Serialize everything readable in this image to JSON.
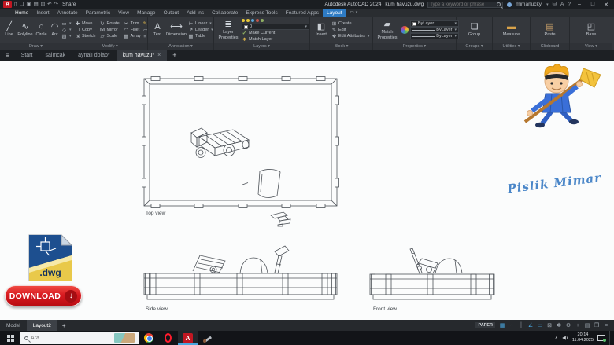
{
  "colors": {
    "tab_active_blue": "#2e7bc4",
    "status_blue": "#4aa7e0",
    "download_red": "#cf1117",
    "watermark_blue": "#4a86c8"
  },
  "titlebar": {
    "logo_letter": "A",
    "quick_icons": [
      {
        "name": "new-file-icon",
        "glyph": "▯"
      },
      {
        "name": "open-folder-icon",
        "glyph": "❒"
      },
      {
        "name": "save-icon",
        "glyph": "▣"
      },
      {
        "name": "save-all-icon",
        "glyph": "▤"
      },
      {
        "name": "plot-icon",
        "glyph": "⊞"
      },
      {
        "name": "undo-icon",
        "glyph": "↶"
      },
      {
        "name": "redo-icon",
        "glyph": "↷"
      }
    ],
    "share_label": "Share",
    "app_title": "Autodesk AutoCAD 2024",
    "doc_title": "kum havuzu.dwg",
    "search_placeholder": "Type a keyword or phrase",
    "username": "mimarlucky",
    "window": {
      "minimize": "–",
      "restore": "□",
      "close": "✕"
    }
  },
  "ribbon_tabs": [
    {
      "label": "Home"
    },
    {
      "label": "Insert"
    },
    {
      "label": "Annotate"
    },
    {
      "label": "Parametric"
    },
    {
      "label": "View"
    },
    {
      "label": "Manage"
    },
    {
      "label": "Output"
    },
    {
      "label": "Add-ins"
    },
    {
      "label": "Collaborate"
    },
    {
      "label": "Express Tools"
    },
    {
      "label": "Featured Apps"
    },
    {
      "label": "Layout"
    }
  ],
  "panels": {
    "draw": {
      "title": "Draw ▾",
      "tools": [
        {
          "glyph": "╱",
          "label": "Line"
        },
        {
          "glyph": "∿",
          "label": "Polyline"
        },
        {
          "glyph": "○",
          "label": "Circle"
        },
        {
          "glyph": "◠",
          "label": "Arc"
        }
      ],
      "minis": [
        {
          "glyph": "▭"
        },
        {
          "glyph": "◇"
        },
        {
          "glyph": "▨"
        }
      ]
    },
    "modify": {
      "title": "Modify ▾",
      "tools": [
        {
          "glyph": "✚",
          "label": "Move"
        },
        {
          "glyph": "❐",
          "label": "Copy"
        },
        {
          "glyph": "⇲",
          "label": "Stretch"
        },
        {
          "glyph": "↻",
          "label": "Rotate"
        },
        {
          "glyph": "⋈",
          "label": "Mirror"
        },
        {
          "glyph": "▱",
          "label": "Scale"
        },
        {
          "glyph": "✂",
          "label": "Trim"
        },
        {
          "glyph": "◠",
          "label": "Fillet"
        },
        {
          "glyph": "▦",
          "label": "Array"
        }
      ],
      "minis": [
        {
          "glyph": "✎"
        },
        {
          "glyph": "▱"
        },
        {
          "glyph": "≡"
        }
      ]
    },
    "annotation": {
      "title": "Annotation ▾",
      "big": [
        {
          "glyph": "A",
          "label": "Text"
        },
        {
          "glyph": "⟷",
          "label": "Dimension"
        }
      ],
      "small": [
        {
          "glyph": "⊢",
          "label": "Linear"
        },
        {
          "glyph": "↗",
          "label": "Leader"
        },
        {
          "glyph": "▦",
          "label": "Table"
        }
      ]
    },
    "layers": {
      "title": "Layers ▾",
      "big_glyph": "≣",
      "big_label": "Layer Properties",
      "layer_value": "0",
      "row1_label": "Make Current",
      "row2_label": "Match Layer",
      "row1_glyph": "✔",
      "row2_glyph": "❖"
    },
    "block": {
      "title": "Block ▾",
      "big_glyph": "◧",
      "big_label": "Insert",
      "rows": [
        {
          "glyph": "⊞",
          "label": "Create"
        },
        {
          "glyph": "✎",
          "label": "Edit"
        },
        {
          "glyph": "❖",
          "label": "Edit Attributes"
        }
      ]
    },
    "properties": {
      "title": "Properties ▾",
      "big_glyph": "▰",
      "big_label": "Match Properties",
      "selects": [
        {
          "value": "ByLayer"
        },
        {
          "value": "ByLayer"
        },
        {
          "value": "ByLayer"
        }
      ]
    },
    "groups": {
      "title": "Groups ▾",
      "big_glyph": "❏",
      "big_label": "Group"
    },
    "utilities": {
      "title": "Utilities ▾",
      "big_glyph": "▬",
      "big_label": "Measure"
    },
    "clipboard": {
      "title": "Clipboard",
      "big_glyph": "▤",
      "big_label": "Paste"
    },
    "view": {
      "title": "View ▾",
      "big_glyph": "◰",
      "big_label": "Base"
    }
  },
  "doc_tabs": {
    "menu_icon": "≡",
    "items": [
      {
        "label": "Start"
      },
      {
        "label": "salıncak"
      },
      {
        "label": "aynalı dolap*"
      },
      {
        "label": "kum havuzu*"
      }
    ],
    "close_glyph": "×",
    "add_glyph": "+"
  },
  "drawing": {
    "top_label": "Top view",
    "side_label": "Side view",
    "front_label": "Front view"
  },
  "watermark": {
    "text": "Pislik Mimar"
  },
  "download": {
    "file_ext": ".dwg",
    "button_label": "DOWNLOAD",
    "arrow_glyph": "↓"
  },
  "layout_bar": {
    "model_tab": "Model",
    "layout_tab": "Layout2",
    "add_glyph": "+",
    "paper_label": "PAPER",
    "status_icons": [
      {
        "name": "grid-icon",
        "glyph": "▦"
      },
      {
        "name": "snap-icon",
        "glyph": "◔"
      },
      {
        "name": "crosshair-icon",
        "glyph": "┼"
      },
      {
        "name": "polar-tracking-icon",
        "glyph": "∠"
      },
      {
        "name": "dynamic-input-icon",
        "glyph": "▭"
      },
      {
        "name": "object-snap-icon",
        "glyph": "⊠"
      },
      {
        "name": "annotation-scale-icon",
        "glyph": "✱"
      },
      {
        "name": "settings-gear-icon",
        "glyph": "⚙"
      },
      {
        "name": "add-icon",
        "glyph": "+"
      },
      {
        "name": "tray-icon",
        "glyph": "▤"
      },
      {
        "name": "clean-screen-icon",
        "glyph": "❒"
      },
      {
        "name": "customize-menu-icon",
        "glyph": "≡"
      }
    ]
  },
  "taskbar": {
    "search_placeholder": "Ara",
    "time": "20:14",
    "date": "11.04.2025"
  }
}
